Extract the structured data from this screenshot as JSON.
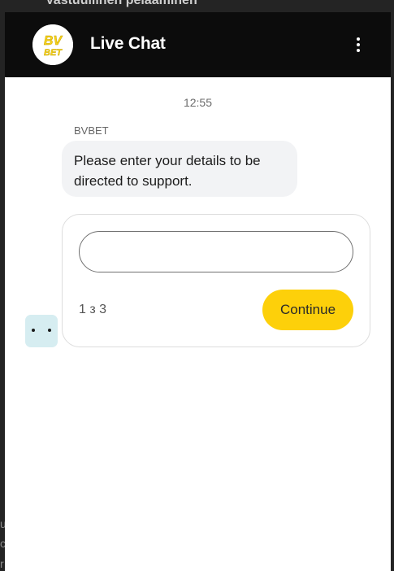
{
  "background_page": {
    "partial_text": "Vastuullinen pelaaminen"
  },
  "header": {
    "logo_text": "BV BET",
    "title": "Live Chat",
    "menu_icon": "more-vertical-icon"
  },
  "conversation": {
    "timestamp": "12:55",
    "sender": "BVBET",
    "message": "Please enter your details to be directed to support."
  },
  "form": {
    "input_value": "",
    "input_placeholder": "",
    "step_indicator": "1 з 3",
    "continue_label": "Continue"
  },
  "agent_avatar": {
    "icon": "bot-face-icon"
  },
  "colors": {
    "header_bg": "#0c0c0c",
    "accent": "#fdd00a",
    "bubble_bg": "#f2f3f5",
    "avatar_bg": "#d6edf1"
  }
}
